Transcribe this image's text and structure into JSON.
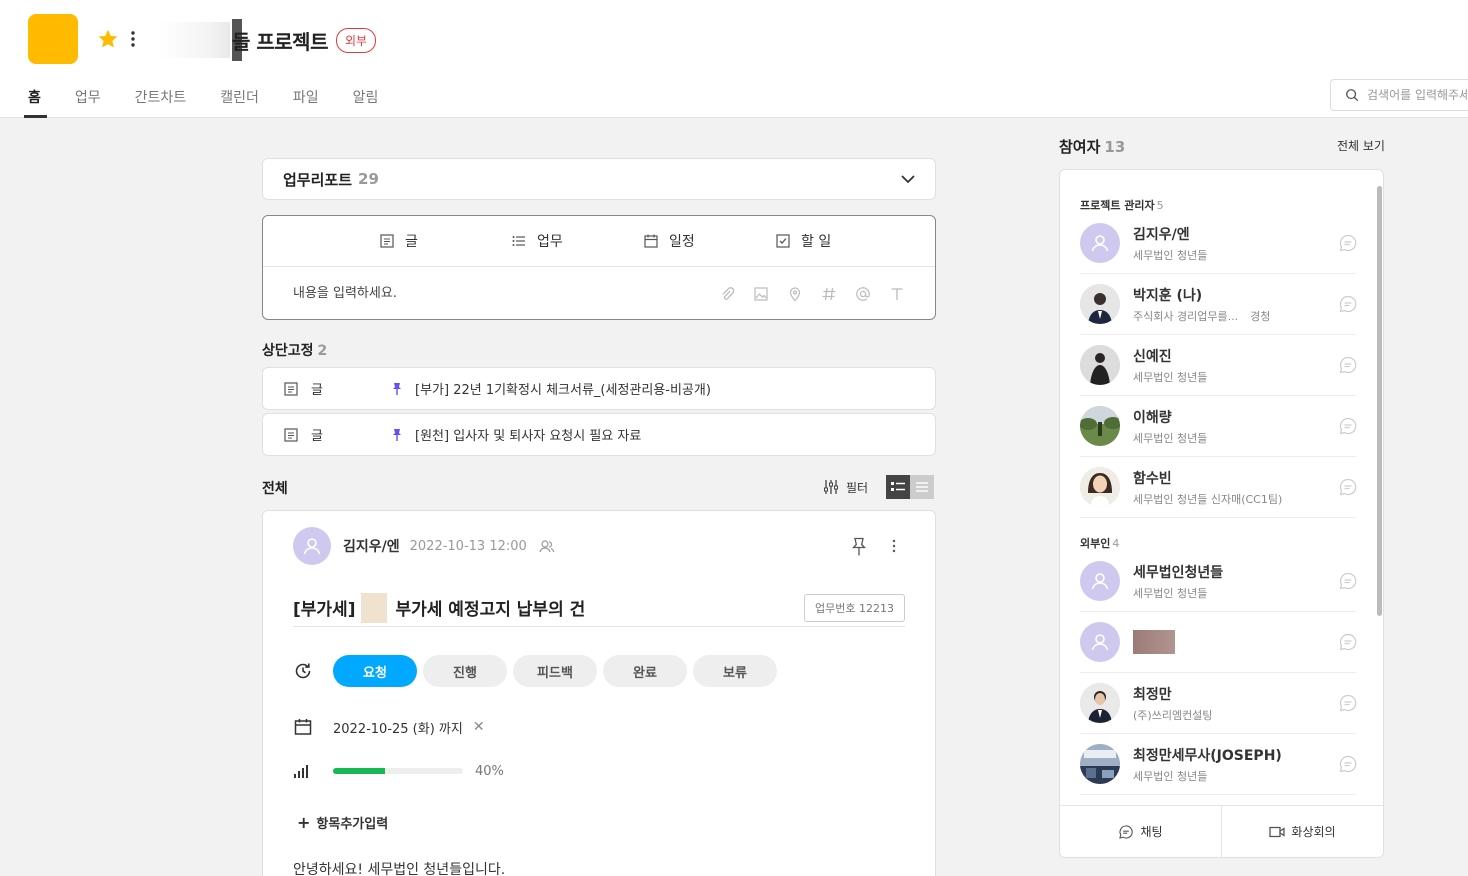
{
  "header": {
    "title": "들 프로젝트",
    "external_badge": "외부",
    "tabs": [
      "홈",
      "업무",
      "간트차트",
      "캘린더",
      "파일",
      "알림"
    ],
    "search_placeholder": "검색어를 입력해주세요",
    "logo_color": "#ffbb00"
  },
  "report": {
    "title": "업무리포트",
    "count": "29"
  },
  "composer": {
    "types": [
      {
        "label": "글",
        "icon": "document-icon"
      },
      {
        "label": "업무",
        "icon": "task-list-icon"
      },
      {
        "label": "일정",
        "icon": "calendar-icon"
      },
      {
        "label": "할 일",
        "icon": "checkbox-icon"
      }
    ],
    "placeholder": "내용을 입력하세요.",
    "tools": [
      "attachment-icon",
      "image-icon",
      "location-icon",
      "hashtag-icon",
      "mention-icon",
      "text-format-icon"
    ]
  },
  "pinned": {
    "label": "상단고정",
    "count": "2",
    "items": [
      {
        "type": "글",
        "text": "[부가] 22년 1기확정시 체크서류_(세정관리용-비공개)"
      },
      {
        "type": "글",
        "text": "[원천] 입사자 및 퇴사자 요청시 필요 자료"
      }
    ]
  },
  "all": {
    "label": "전체",
    "filter_label": "필터"
  },
  "post": {
    "author": "김지우/엔",
    "time": "2022-10-13 12:00",
    "title_prefix": "[부가세]",
    "title_suffix": "부가세 예정고지 납부의 건",
    "task_number": "업무번호 12213",
    "statuses": [
      "요청",
      "진행",
      "피드백",
      "완료",
      "보류"
    ],
    "active_status": "요청",
    "due": "2022-10-25 (화) 까지",
    "progress": 40,
    "progress_label": "40%",
    "add_field": "항목추가입력",
    "body": "안녕하세요! 세무법인 청년들입니다.",
    "accent_color": "#00a8ff",
    "progress_color": "#16b852"
  },
  "participants": {
    "title": "참여자",
    "count": "13",
    "view_all": "전체 보기",
    "groups": [
      {
        "label": "프로젝트 관리자",
        "count": "5",
        "members": [
          {
            "name": "김지우/엔",
            "org": "세무법인 청년들",
            "role": "",
            "avatar": "default"
          },
          {
            "name": "박지훈 (나)",
            "org": "주식회사 경리업무를...",
            "role": "경청",
            "avatar": "photo"
          },
          {
            "name": "신예진",
            "org": "세무법인 청년들",
            "role": "",
            "avatar": "photo"
          },
          {
            "name": "이해량",
            "org": "세무법인 청년들",
            "role": "",
            "avatar": "photo"
          },
          {
            "name": "함수빈",
            "org": "세무법인 청년들 신자매(CC1팀)",
            "role": "",
            "avatar": "photo"
          }
        ]
      },
      {
        "label": "외부인",
        "count": "4",
        "members": [
          {
            "name": "세무법인청년들",
            "org": "세무법인 청년들",
            "role": "",
            "avatar": "default"
          },
          {
            "name": "",
            "org": "",
            "role": "",
            "avatar": "default"
          },
          {
            "name": "최정만",
            "org": "(주)쓰리엠컨설팅",
            "role": "",
            "avatar": "photo"
          },
          {
            "name": "최정만세무사(JOSEPH)",
            "org": "세무법인 청년들",
            "role": "",
            "avatar": "photo"
          }
        ]
      }
    ],
    "actions": [
      "채팅",
      "화상회의"
    ]
  }
}
